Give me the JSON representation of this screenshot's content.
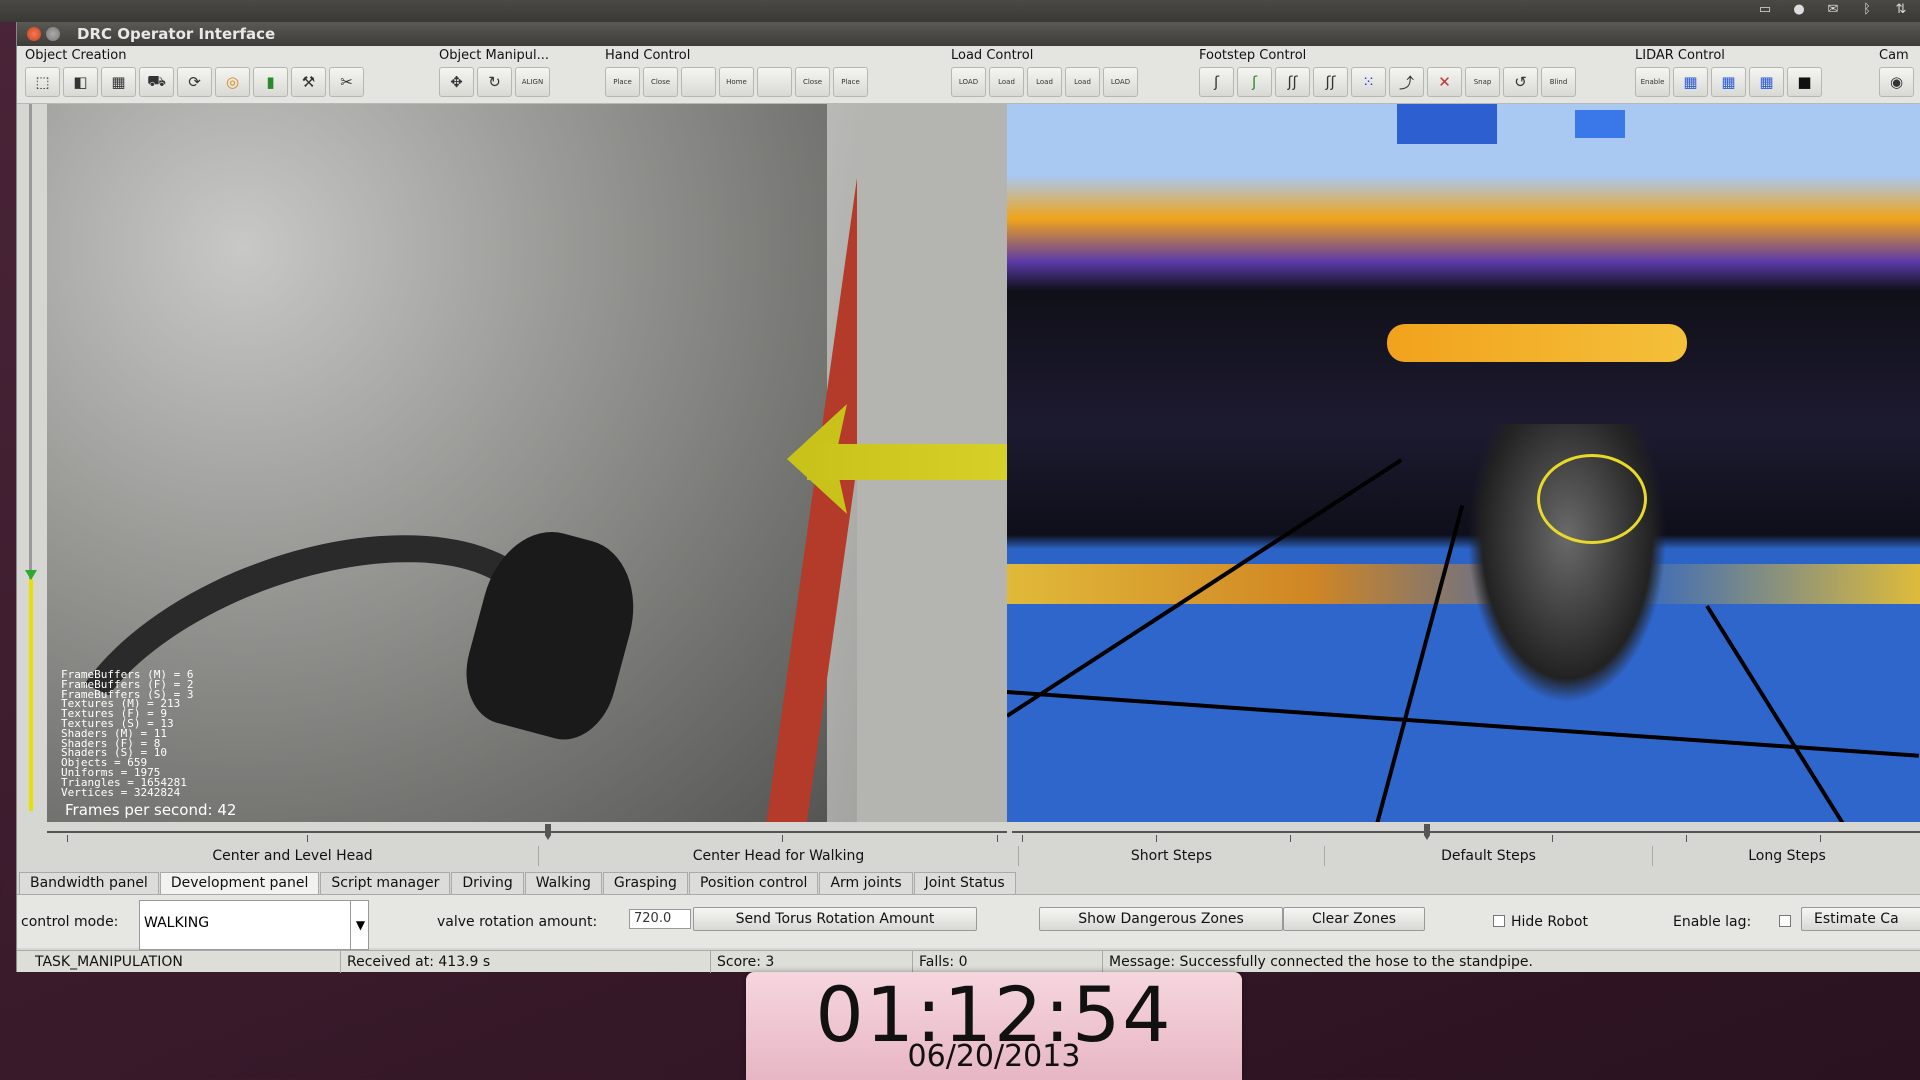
{
  "window": {
    "title": "DRC Operator Interface"
  },
  "toolbar": {
    "groups": [
      {
        "label": "Object Creation",
        "icons": [
          "select-icon",
          "box-icon",
          "grid-icon",
          "vehicle-icon",
          "update-icon",
          "torus-icon",
          "cylinder-icon",
          "tool-icon",
          "cut-icon"
        ]
      },
      {
        "label": "Object Manipul...",
        "icons": [
          "move-icon",
          "rotate-icon",
          "align-icon"
        ],
        "align_label": "ALIGN"
      },
      {
        "label": "Hand Control",
        "icons": [
          "place-hand-icon",
          "close-hand-icon",
          "blank-icon",
          "home-hand-icon",
          "blank-icon",
          "close-hand-icon",
          "place-hand-icon"
        ],
        "labels": [
          "Place",
          "Close",
          "",
          "Home",
          "",
          "Close",
          "Place"
        ]
      },
      {
        "label": "Load Control",
        "icons": [
          "load-icon",
          "load-icon",
          "load-icon",
          "load-icon",
          "load-icon"
        ],
        "labels": [
          "LOAD",
          "Load",
          "Load",
          "Load",
          "LOAD"
        ]
      },
      {
        "label": "Footstep Control",
        "icons": [
          "foot-icon",
          "foot-icon",
          "foot-icon",
          "foot-icon",
          "footstep-grid-icon",
          "footstep-icon",
          "footstep-cancel-icon",
          "snap-icon",
          "loop-icon",
          "blind-icon"
        ],
        "labels": [
          "",
          "",
          "",
          "",
          "",
          "",
          "",
          "Snap",
          "",
          "Blind"
        ]
      },
      {
        "label": "LIDAR Control",
        "icons": [
          "lidar-enable-icon",
          "lidar-icon",
          "lidar-icon",
          "lidar-icon",
          "lidar-black-icon"
        ],
        "labels": [
          "Enable",
          "",
          "",
          "",
          ""
        ]
      },
      {
        "label": "Cam",
        "icons": [
          "camera-icon"
        ]
      }
    ]
  },
  "camera_view": {
    "stats": "FrameBuffers (M) = 6\nFrameBuffers (F) = 2\nFrameBuffers (S) = 3\nTextures (M) = 213\nTextures (F) = 9\nTextures (S) = 13\nShaders (M) = 11\nShaders (F) = 8\nShaders (S) = 10\nObjects = 659\nUniforms = 1975\nTriangles = 1654281\nVertices = 3242824",
    "fps_label": "Frames per second: 42"
  },
  "head_presets": [
    "Center and Level Head",
    "Center Head for Walking"
  ],
  "step_presets": [
    "Short Steps",
    "Default Steps",
    "Long Steps"
  ],
  "tabs": [
    "Bandwidth panel",
    "Development panel",
    "Script manager",
    "Driving",
    "Walking",
    "Grasping",
    "Position control",
    "Arm joints",
    "Joint Status"
  ],
  "active_tab": "Development panel",
  "controls": {
    "control_mode_label": "control mode:",
    "control_mode_value": "WALKING",
    "valve_label": "valve rotation amount:",
    "valve_value": "720.0",
    "send_torus_button": "Send Torus Rotation Amount",
    "show_zones_button": "Show Dangerous Zones",
    "clear_zones_button": "Clear Zones",
    "hide_robot_label": "Hide Robot",
    "enable_lag_label": "Enable lag:",
    "estimate_button": "Estimate Ca"
  },
  "status": {
    "task": "TASK_MANIPULATION",
    "received": "Received at:  413.9 s",
    "score": "Score:  3",
    "falls": "Falls:  0",
    "message": "Message:  Successfully connected the hose to the standpipe."
  },
  "clock": {
    "time": "01:12:54",
    "date": "06/20/2013"
  }
}
